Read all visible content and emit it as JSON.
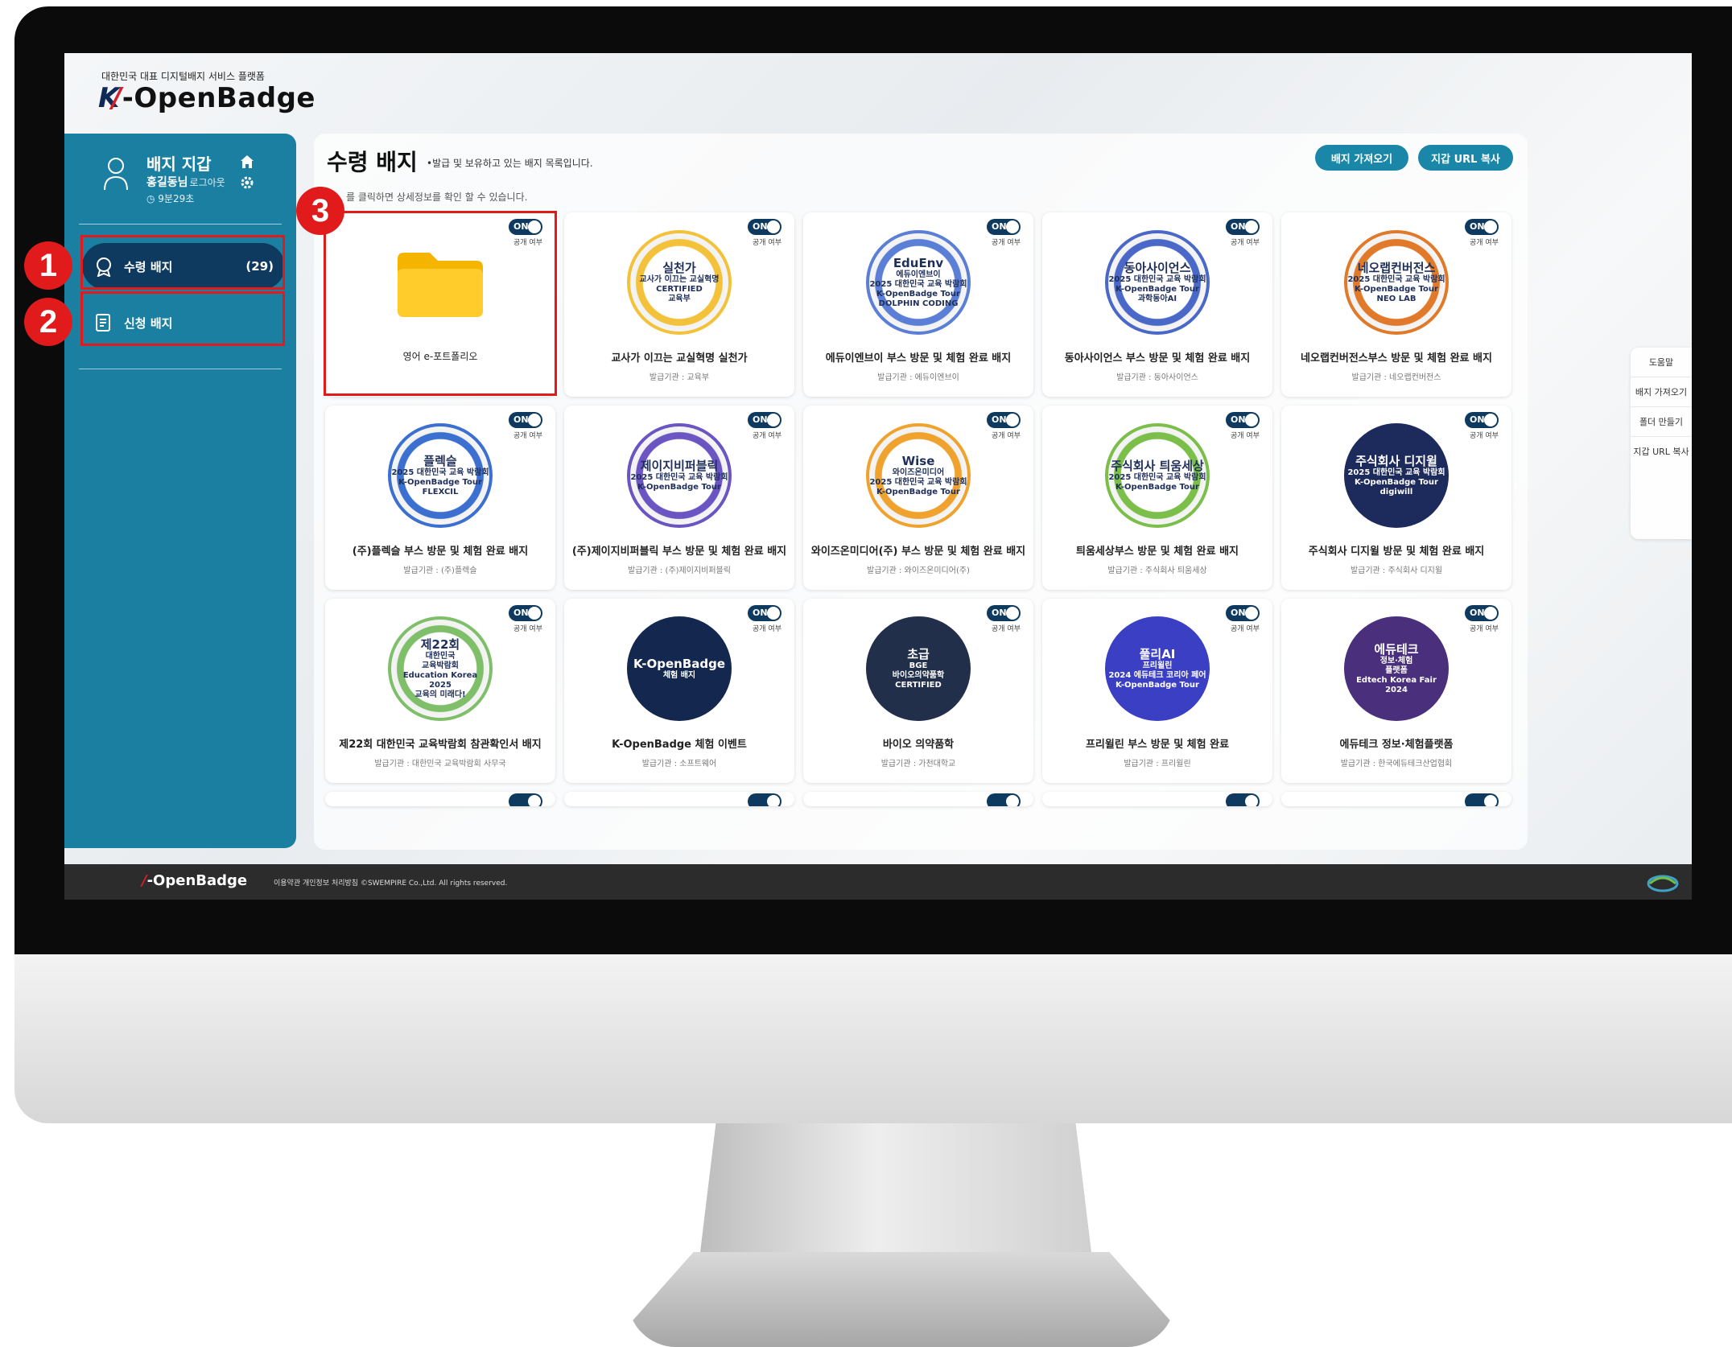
{
  "brand": {
    "tagline": "대한민국 대표 디지털배지 서비스 플랫폼",
    "name": "-OpenBadge"
  },
  "sidebar": {
    "title": "배지 지갑",
    "user": "홍길동님",
    "logout": "로그아웃",
    "session_time": "9분29초",
    "items": [
      {
        "label": "수령 배지",
        "count": "(29)",
        "icon": "badge-icon"
      },
      {
        "label": "신청 배지",
        "icon": "apply-icon"
      }
    ]
  },
  "callouts": [
    "1",
    "2",
    "3"
  ],
  "main": {
    "title": "수령 배지",
    "subtitle": "•발급 및 보유하고 있는 배지 목록입니다.",
    "hint": "를 클릭하면 상세정보를 확인 할 수 있습니다.",
    "buttons": {
      "import": "배지 가져오기",
      "copy_url": "지갑 URL 복사"
    }
  },
  "toggle": {
    "state": "ON",
    "label": "공개 여부"
  },
  "cards": [
    {
      "title": "영어 e-포트폴리오",
      "issuer": "",
      "kind": "folder"
    },
    {
      "title": "교사가 이끄는 교실혁명 실천가",
      "issuer": "발급기관 : 교육부",
      "lines": [
        "실천가",
        "교사가 이끄는 교실혁명",
        "CERTIFIED",
        "교육부"
      ],
      "color": "#f3c23a"
    },
    {
      "title": "에듀이엔브이 부스 방문 및 체험 완료 배지",
      "issuer": "발급기관 : 에듀이엔브이",
      "lines": [
        "EduEnv",
        "에듀이엔브이",
        "2025 대한민국 교육 박람회",
        "K-OpenBadge Tour",
        "DOLPHIN CODING"
      ],
      "color": "#5b7fd6"
    },
    {
      "title": "동아사이언스 부스 방문 및 체험 완료 배지",
      "issuer": "발급기관 : 동아사이언스",
      "lines": [
        "동아사이언스",
        "2025 대한민국 교육 박람회",
        "K-OpenBadge Tour",
        "과학동아AI"
      ],
      "color": "#4a68c8"
    },
    {
      "title": "네오랩컨버전스부스 방문 및 체험 완료 배지",
      "issuer": "발급기관 : 네오랩컨버전스",
      "lines": [
        "네오랩컨버전스",
        "2025 대한민국 교육 박람회",
        "K-OpenBadge Tour",
        "NEO LAB"
      ],
      "color": "#e07a2a"
    },
    {
      "title": "(주)플렉슬 부스 방문 및 체험 완료 배지",
      "issuer": "발급기관 : (주)플렉슬",
      "lines": [
        "플렉슬",
        "2025 대한민국 교육 박람회",
        "K-OpenBadge Tour",
        "FLEXCIL"
      ],
      "color": "#3b6fd0"
    },
    {
      "title": "(주)제이지비퍼블릭 부스 방문 및 체험 완료 배지",
      "issuer": "발급기관 : (주)제이지비퍼블릭",
      "lines": [
        "제이지비퍼블릭",
        "2025 대한민국 교육 박람회",
        "K-OpenBadge Tour"
      ],
      "color": "#6a55c2"
    },
    {
      "title": "와이즈온미디어(주) 부스 방문 및 체험 완료 배지",
      "issuer": "발급기관 : 와이즈온미디어(주)",
      "lines": [
        "Wise",
        "와이즈온미디어",
        "2025 대한민국 교육 박람회",
        "K-OpenBadge Tour"
      ],
      "color": "#f0a22e"
    },
    {
      "title": "틔움세상부스 방문 및 체험 완료 배지",
      "issuer": "발급기관 : 주식회사 틔움세상",
      "lines": [
        "주식회사 틔움세상",
        "2025 대한민국 교육 박람회",
        "K-OpenBadge Tour"
      ],
      "color": "#7bbf4a"
    },
    {
      "title": "주식회사 디지윌 방문 및 체험 완료 배지",
      "issuer": "발급기관 : 주식회사 디지윌",
      "lines": [
        "주식회사 디지윌",
        "2025 대한민국 교육 박람회",
        "K-OpenBadge Tour",
        "digiwill"
      ],
      "color": "#1d2a5c"
    },
    {
      "title": "제22회 대한민국 교육박람회 참관확인서 배지",
      "issuer": "발급기관 : 대한민국 교육박람회 사무국",
      "lines": [
        "제22회",
        "대한민국",
        "교육박람회",
        "Education Korea 2025",
        "교육의 미래다!"
      ],
      "color": "#7fbf6a"
    },
    {
      "title": "K-OpenBadge 체험 이벤트",
      "issuer": "발급기관 : 소프트웨어",
      "lines": [
        "K-OpenBadge",
        "체험 배지"
      ],
      "color": "#14284f"
    },
    {
      "title": "바이오 의약품학",
      "issuer": "발급기관 : 가천대학교",
      "lines": [
        "초급",
        "BGE",
        "바이오의약품학",
        "CERTIFIED"
      ],
      "color": "#222f4a"
    },
    {
      "title": "프리윌린 부스 방문 및 체험 완료",
      "issuer": "발급기관 : 프리윌린",
      "lines": [
        "풀리AI",
        "프리윌린",
        "2024 에듀테크 코리아 페어",
        "K-OpenBadge Tour"
      ],
      "color": "#3a3fc4"
    },
    {
      "title": "에듀테크 정보·체험플랫폼",
      "issuer": "발급기관 : 한국에듀테크산업협회",
      "lines": [
        "에듀테크",
        "정보·체험",
        "플랫폼",
        "Edtech Korea Fair 2024"
      ],
      "color": "#4a2f7c"
    }
  ],
  "help": {
    "title": "도움말",
    "items": [
      "배지 가져오기",
      "폴더 만들기",
      "지갑 URL 복사"
    ]
  },
  "footer": {
    "logo": "-OpenBadge",
    "links": "이용약관    개인정보 처리방침    ©SWEMPIRE Co.,Ltd. All rights reserved."
  }
}
